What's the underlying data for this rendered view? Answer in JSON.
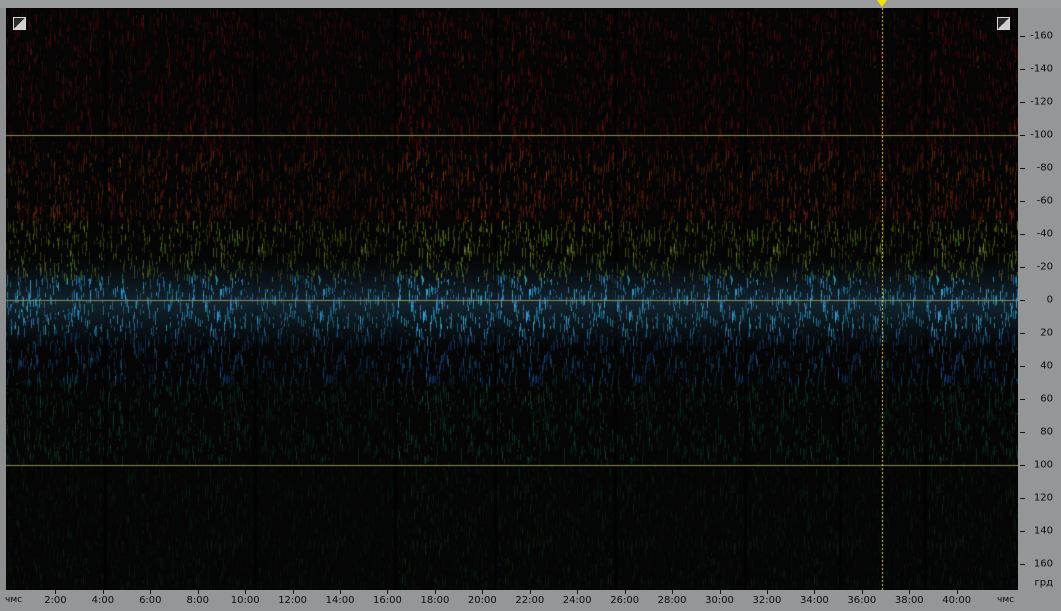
{
  "spectral_view": {
    "background_color": "#050505",
    "grid_color": "#8a8a56",
    "playhead_color": "#ffd84a",
    "marker_color": "#f2e200",
    "y_axis": {
      "unit": "грд",
      "labels": [
        "-160",
        "-140",
        "-120",
        "-100",
        "-80",
        "-60",
        "-40",
        "-20",
        "0",
        "20",
        "40",
        "60",
        "80",
        "100",
        "120",
        "140",
        "160"
      ]
    },
    "x_axis": {
      "unit_left": "чмс",
      "unit_right": "чмс",
      "labels": [
        "2:00",
        "4:00",
        "6:00",
        "8:00",
        "10:00",
        "12:00",
        "14:00",
        "16:00",
        "18:00",
        "20:00",
        "22:00",
        "24:00",
        "26:00",
        "28:00",
        "30:00",
        "32:00",
        "34:00",
        "36:00",
        "38:00",
        "40:00"
      ]
    },
    "playhead_time": "36:50",
    "grid_lines_y": [
      "-100",
      "0",
      "100"
    ]
  }
}
